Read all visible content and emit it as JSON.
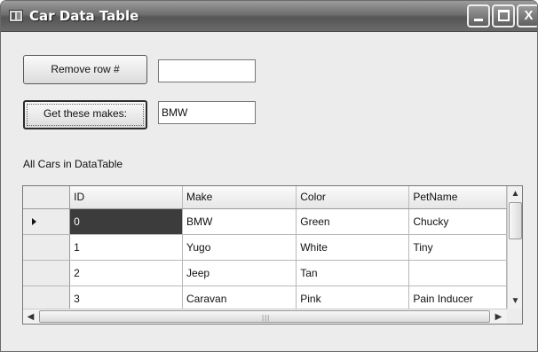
{
  "window": {
    "title": "Car Data Table",
    "minimize_label": "_",
    "maximize_label": "□",
    "close_label": "X"
  },
  "controls": {
    "remove_button_label": "Remove row #",
    "remove_input_value": "",
    "get_makes_button_label": "Get these makes:",
    "make_input_value": "BMW"
  },
  "grid": {
    "caption": "All Cars in DataTable",
    "columns": [
      "ID",
      "Make",
      "Color",
      "PetName"
    ],
    "rows": [
      [
        "0",
        "BMW",
        "Green",
        "Chucky"
      ],
      [
        "1",
        "Yugo",
        "White",
        "Tiny"
      ],
      [
        "2",
        "Jeep",
        "Tan",
        ""
      ],
      [
        "3",
        "Caravan",
        "Pink",
        "Pain Inducer"
      ]
    ],
    "current_row_index": 0,
    "scroll_up": "▲",
    "scroll_down": "▼",
    "scroll_left": "◀",
    "scroll_right": "▶"
  },
  "colors": {
    "titlebar": "#6e6e6e",
    "selected_cell": "#3c3c3c",
    "window_bg": "#ececec"
  }
}
